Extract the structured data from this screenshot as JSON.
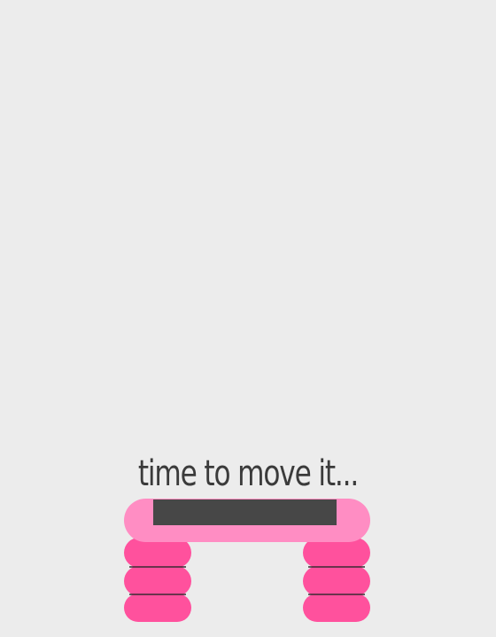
{
  "caption": {
    "text": "time to move it..."
  },
  "colors": {
    "background": "#ECECEC",
    "platform": "#FF8DC3",
    "platform_top_pad": "#474747",
    "riser": "#FF519D",
    "riser_seam": "#3A2A33",
    "text": "#3B3B3B"
  },
  "illustration": {
    "subject": "aerobic step platform",
    "riser_blocks_per_side": 3
  }
}
